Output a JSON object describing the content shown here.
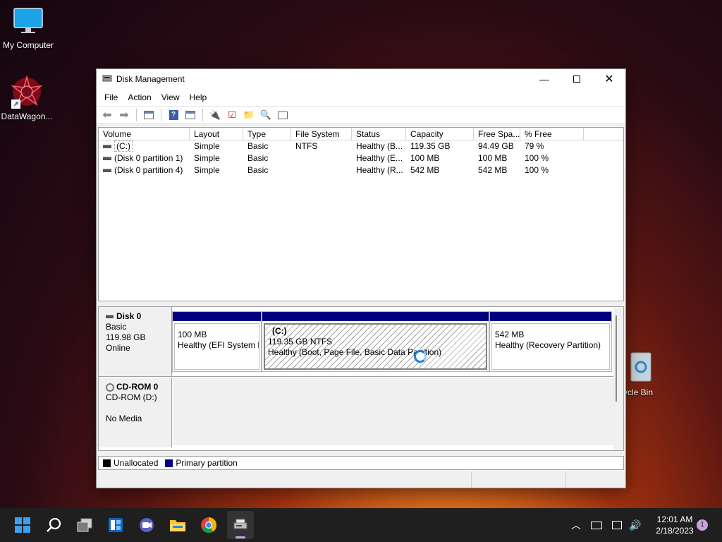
{
  "desktop": {
    "icons": [
      {
        "label": "My Computer"
      },
      {
        "label": "DataWagon..."
      },
      {
        "label": "ycle Bin"
      }
    ]
  },
  "window": {
    "title": "Disk Management",
    "menu": [
      "File",
      "Action",
      "View",
      "Help"
    ]
  },
  "volumes": {
    "columns": [
      "Volume",
      "Layout",
      "Type",
      "File System",
      "Status",
      "Capacity",
      "Free Spa...",
      "% Free"
    ],
    "rows": [
      {
        "volume": "(C:)",
        "layout": "Simple",
        "type": "Basic",
        "fs": "NTFS",
        "status": "Healthy (B...",
        "capacity": "119.35 GB",
        "free": "94.49 GB",
        "pct": "79 %"
      },
      {
        "volume": "(Disk 0 partition 1)",
        "layout": "Simple",
        "type": "Basic",
        "fs": "",
        "status": "Healthy (E...",
        "capacity": "100 MB",
        "free": "100 MB",
        "pct": "100 %"
      },
      {
        "volume": "(Disk 0 partition 4)",
        "layout": "Simple",
        "type": "Basic",
        "fs": "",
        "status": "Healthy (R...",
        "capacity": "542 MB",
        "free": "542 MB",
        "pct": "100 %"
      }
    ]
  },
  "disks": [
    {
      "name": "Disk 0",
      "type": "Basic",
      "size": "119.98 GB",
      "state": "Online",
      "partitions": [
        {
          "label": "",
          "size": "100 MB",
          "status": "Healthy (EFI System P"
        },
        {
          "label": "(C:)",
          "size": "119.35 GB NTFS",
          "status": "Healthy (Boot, Page File, Basic Data Partition)"
        },
        {
          "label": "",
          "size": "542 MB",
          "status": "Healthy (Recovery Partition)"
        }
      ]
    },
    {
      "name": "CD-ROM 0",
      "type": "CD-ROM (D:)",
      "media": "No Media"
    }
  ],
  "legend": {
    "unallocated": "Unallocated",
    "primary": "Primary partition"
  },
  "colors": {
    "primary": "#000080",
    "unallocated": "#000000"
  },
  "taskbar": {
    "icons": [
      "windows-start-icon",
      "search-icon",
      "task-view-icon",
      "widgets-icon",
      "chat-icon",
      "file-explorer-icon",
      "chrome-icon",
      "disk-management-icon"
    ],
    "time": "12:01 AM",
    "date": "2/18/2023",
    "notifications": "1"
  }
}
